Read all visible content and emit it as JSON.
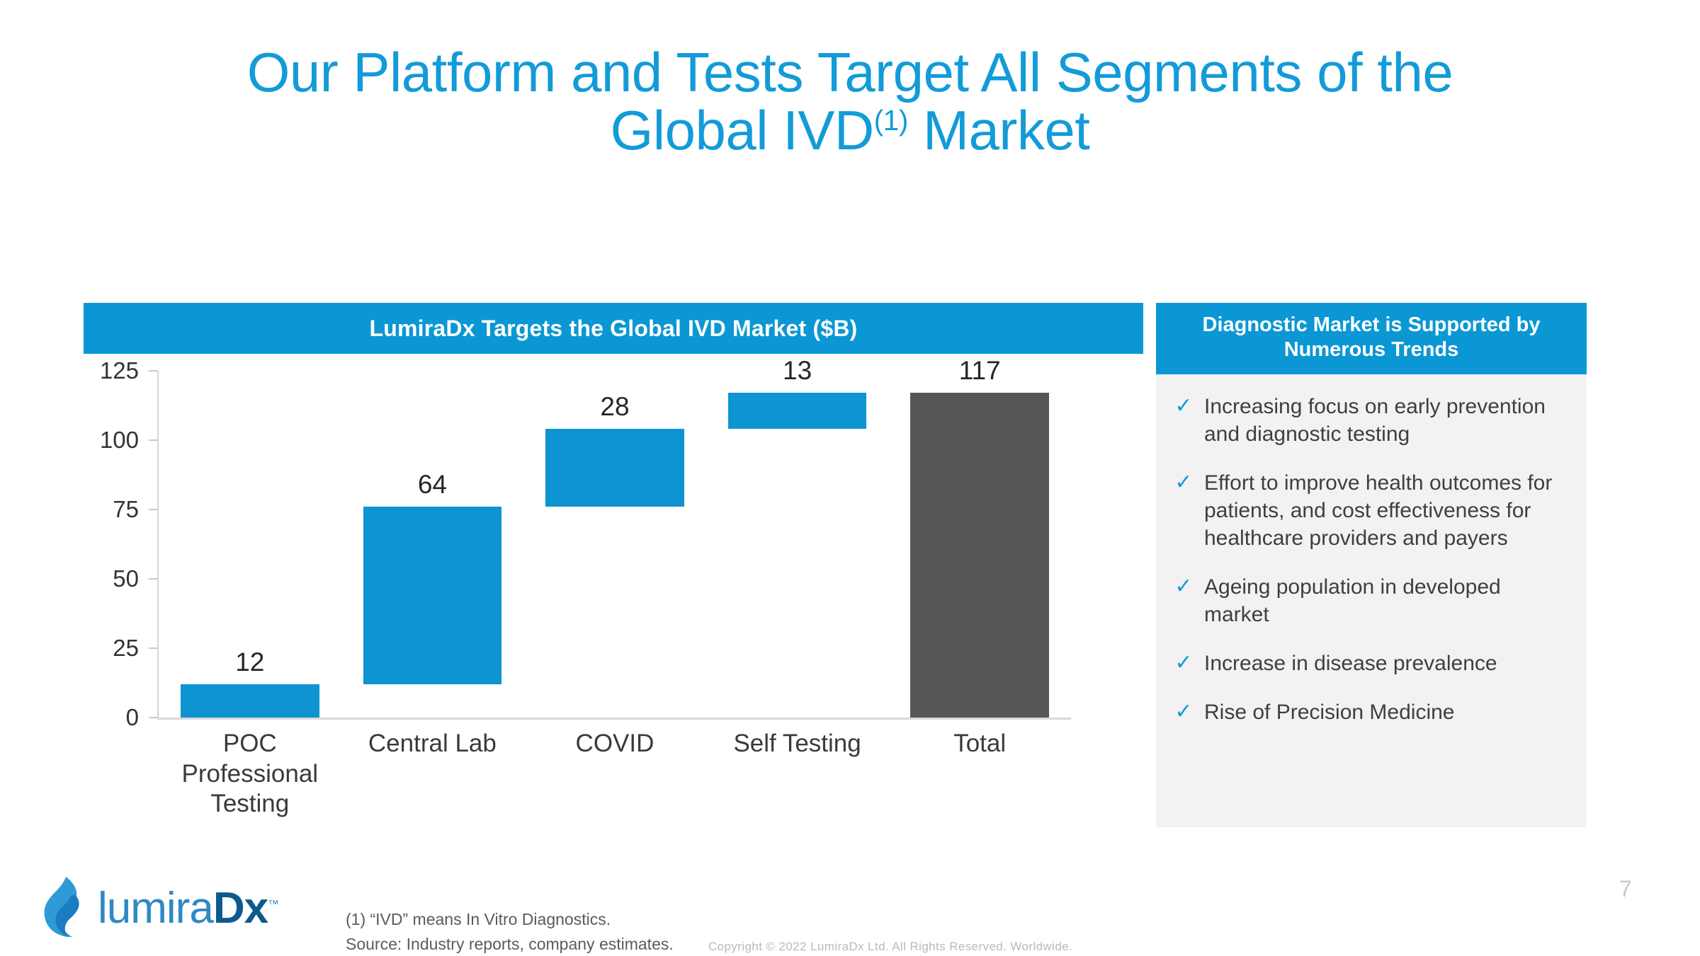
{
  "slide": {
    "title_line1": "Our Platform and Tests Target All Segments of the",
    "title_line2_pre": "Global IVD",
    "title_superscript": "(1)",
    "title_line2_post": " Market",
    "page_number": "7",
    "accent_blue": "#129bd8",
    "header_blue": "#0b97d4",
    "bar_blue": "#0d94d1",
    "total_gray": "#565656",
    "panel_gray": "#f2f2f2"
  },
  "chart_panel": {
    "header": "LumiraDx Targets the Global IVD Market ($B)"
  },
  "chart_data": {
    "type": "bar",
    "subtype": "waterfall",
    "title": "LumiraDx Targets the Global IVD Market ($B)",
    "xlabel": "",
    "ylabel": "",
    "ylim": [
      0,
      125
    ],
    "yticks": [
      0,
      25,
      50,
      75,
      100,
      125
    ],
    "ytick_labels": [
      "0",
      "25",
      "50",
      "75",
      "100",
      "125"
    ],
    "grid": false,
    "legend": "none",
    "categories": [
      "POC Professional Testing",
      "Central Lab",
      "COVID",
      "Self Testing",
      "Total"
    ],
    "values": [
      12,
      64,
      28,
      13,
      117
    ],
    "data_labels": [
      "12",
      "64",
      "28",
      "13",
      "117"
    ],
    "bars": [
      {
        "category": "POC Professional Testing",
        "label": "12",
        "value": 12,
        "base": 0,
        "top": 12,
        "color": "#0d94d1",
        "kind": "increase"
      },
      {
        "category": "Central Lab",
        "label": "64",
        "value": 64,
        "base": 12,
        "top": 76,
        "color": "#0d94d1",
        "kind": "increase"
      },
      {
        "category": "COVID",
        "label": "28",
        "value": 28,
        "base": 76,
        "top": 104,
        "color": "#0d94d1",
        "kind": "increase"
      },
      {
        "category": "Self Testing",
        "label": "13",
        "value": 13,
        "base": 104,
        "top": 117,
        "color": "#0d94d1",
        "kind": "increase"
      },
      {
        "category": "Total",
        "label": "117",
        "value": 117,
        "base": 0,
        "top": 117,
        "color": "#565656",
        "kind": "total"
      }
    ],
    "category_lines": [
      [
        "POC",
        "Professional",
        "Testing"
      ],
      [
        "Central Lab"
      ],
      [
        "COVID"
      ],
      [
        "Self Testing"
      ],
      [
        "Total"
      ]
    ]
  },
  "trends_panel": {
    "header_line1": "Diagnostic Market is Supported by",
    "header_line2": "Numerous Trends",
    "check_glyph": "✓",
    "items": [
      "Increasing focus on early prevention and diagnostic testing",
      "Effort to improve health outcomes for patients, and cost effectiveness for healthcare providers and payers",
      "Ageing population in developed market",
      "Increase in disease prevalence",
      "Rise of Precision Medicine"
    ]
  },
  "footer": {
    "logo_text_light": "lumira",
    "logo_text_bold": "Dx",
    "logo_tm": "™",
    "footnote_1": "(1) “IVD” means In Vitro Diagnostics.",
    "footnote_2": "Source: Industry reports, company estimates.",
    "copyright": "Copyright © 2022  LumiraDx Ltd.  All Rights Reserved.  Worldwide."
  }
}
